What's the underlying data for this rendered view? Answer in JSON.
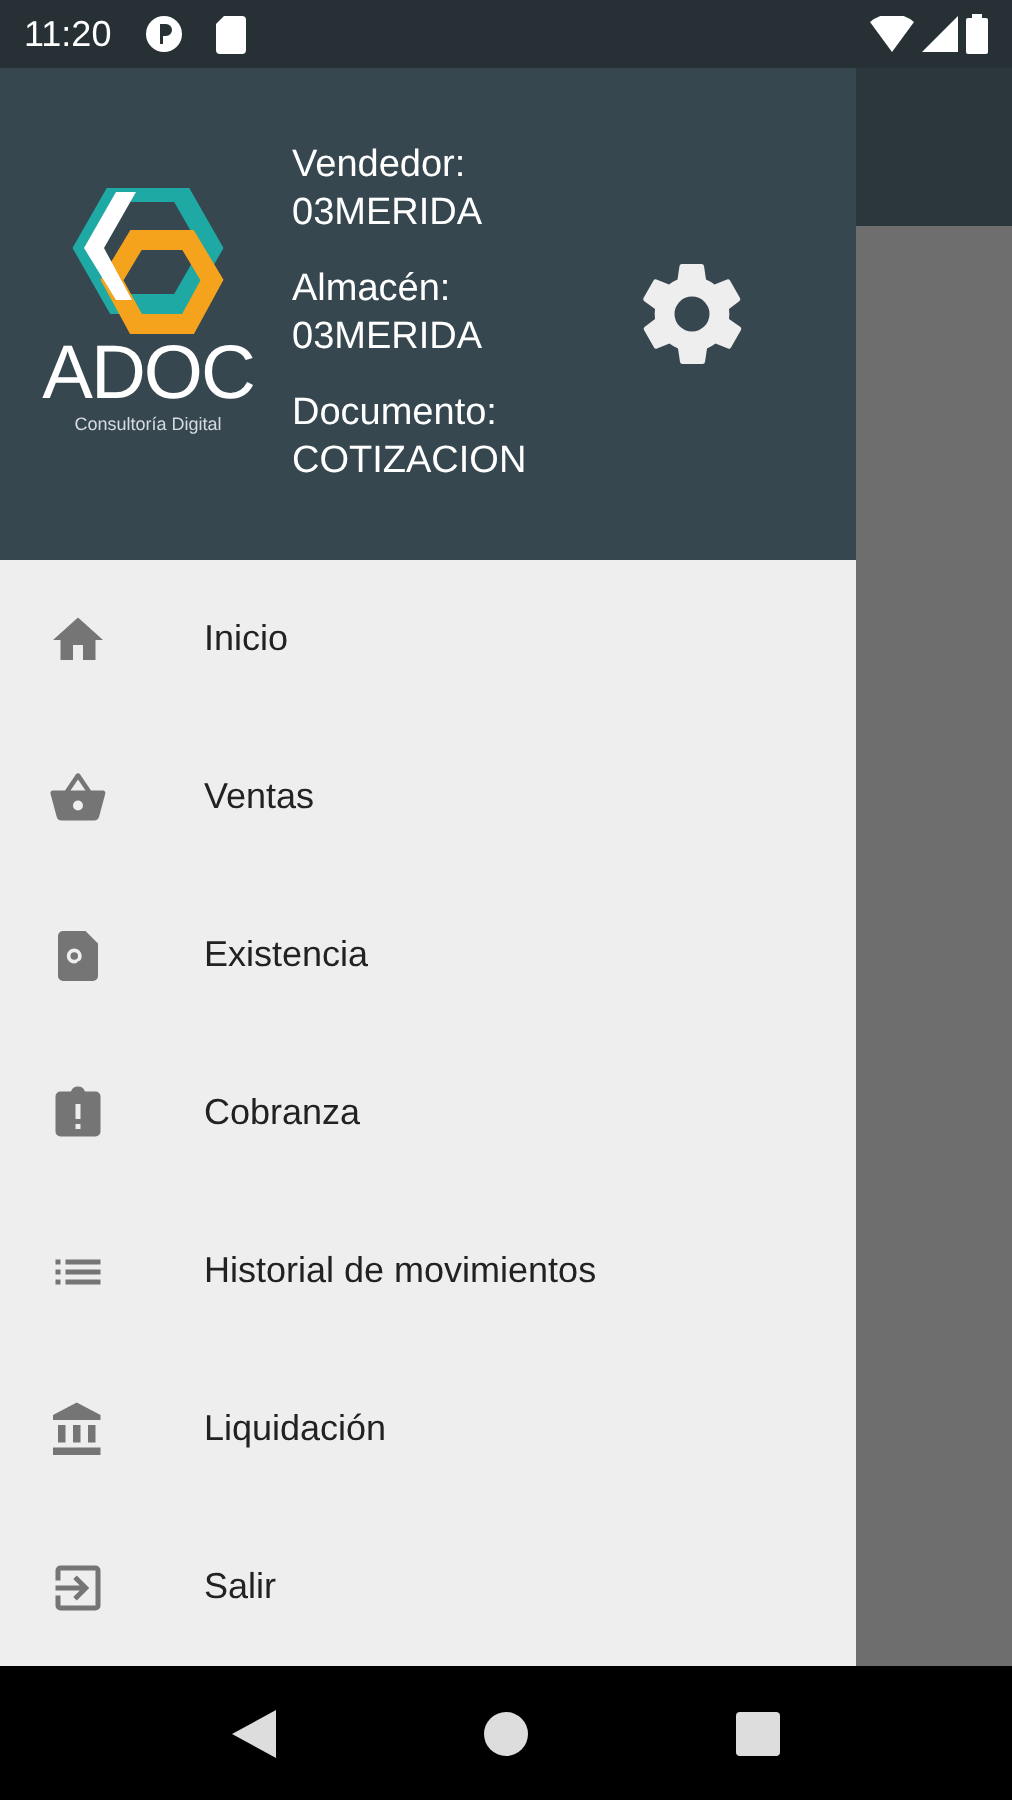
{
  "status_bar": {
    "time": "11:20"
  },
  "header": {
    "logo": {
      "name": "ADOC",
      "tagline": "Consultoría Digital"
    },
    "fields": [
      {
        "label": "Vendedor:",
        "value": "03MERIDA"
      },
      {
        "label": "Almacén:",
        "value": "03MERIDA"
      },
      {
        "label": "Documento:",
        "value": "COTIZACION"
      }
    ]
  },
  "menu": [
    {
      "label": "Inicio"
    },
    {
      "label": "Ventas"
    },
    {
      "label": "Existencia"
    },
    {
      "label": "Cobranza"
    },
    {
      "label": "Historial de movimientos"
    },
    {
      "label": "Liquidación"
    },
    {
      "label": "Salir"
    }
  ]
}
